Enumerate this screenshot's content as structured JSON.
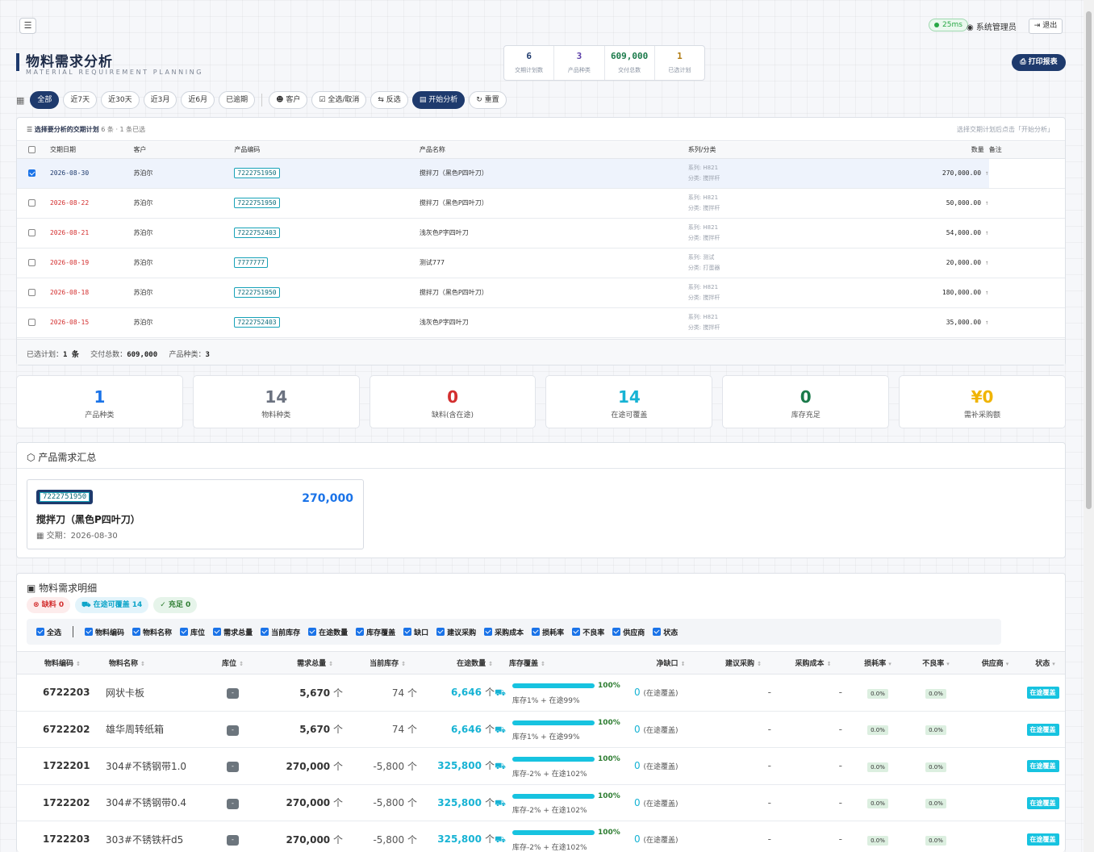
{
  "header": {
    "ping": "25ms",
    "user": "系统管理员",
    "logout": "退出",
    "title": "物料需求分析",
    "subtitle": "MATERIAL REQUIREMENT PLANNING",
    "print": "打印报表"
  },
  "stats": [
    {
      "value": "6",
      "label": "交期计划数",
      "color": "#1e3a6d"
    },
    {
      "value": "3",
      "label": "产品种类",
      "color": "#5b3ea8"
    },
    {
      "value": "609,000",
      "label": "交付总数",
      "color": "#1a7a4a"
    },
    {
      "value": "1",
      "label": "已选计划",
      "color": "#b07a10"
    }
  ],
  "filters": {
    "all": "全部",
    "d7": "近7天",
    "d30": "近30天",
    "m3": "近3月",
    "m6": "近6月",
    "overdue": "已逾期",
    "customer": "客户",
    "toggle_all": "全选/取消",
    "invert": "反选",
    "analyze": "开始分析",
    "reset": "重置"
  },
  "plans": {
    "title": "选择要分析的交期计划",
    "count": "6 条 · 1 条已选",
    "hint": "选择交期计划后点击「开始分析」",
    "columns": [
      "交期日期",
      "客户",
      "产品编码",
      "产品名称",
      "系列/分类",
      "数量",
      "备注"
    ],
    "rows": [
      {
        "date": "2026-08-30",
        "customer": "苏泊尔",
        "code": "7222751950",
        "name": "搅拌刀（黑色P四叶刀）",
        "series": "系列: H821",
        "category": "分类: 搅拌杆",
        "qty": "270,000.00"
      },
      {
        "date": "2026-08-22",
        "customer": "苏泊尔",
        "code": "7222751950",
        "name": "搅拌刀（黑色P四叶刀）",
        "series": "系列: H821",
        "category": "分类: 搅拌杆",
        "qty": "50,000.00"
      },
      {
        "date": "2026-08-21",
        "customer": "苏泊尔",
        "code": "7222752403",
        "name": "浅灰色P字四叶刀",
        "series": "系列: H821",
        "category": "分类: 搅拌杆",
        "qty": "54,000.00"
      },
      {
        "date": "2026-08-19",
        "customer": "苏泊尔",
        "code": "7777777",
        "name": "测试777",
        "series": "系列: 测试",
        "category": "分类: 打蛋器",
        "qty": "20,000.00"
      },
      {
        "date": "2026-08-18",
        "customer": "苏泊尔",
        "code": "7222751950",
        "name": "搅拌刀（黑色P四叶刀）",
        "series": "系列: H821",
        "category": "分类: 搅拌杆",
        "qty": "180,000.00"
      },
      {
        "date": "2026-08-15",
        "customer": "苏泊尔",
        "code": "7222752403",
        "name": "浅灰色P字四叶刀",
        "series": "系列: H821",
        "category": "分类: 搅拌杆",
        "qty": "35,000.00"
      }
    ],
    "footer": {
      "selected_label": "已选计划：",
      "selected": "1 条",
      "total_label": "交付总数：",
      "total": "609,000",
      "kinds_label": "产品种类：",
      "kinds": "3"
    }
  },
  "summary_cards": [
    {
      "value": "1",
      "label": "产品种类",
      "color": "#1a73e8"
    },
    {
      "value": "14",
      "label": "物料种类",
      "color": "#6b7280"
    },
    {
      "value": "0",
      "label": "缺料(含在途)",
      "color": "#d32f2f"
    },
    {
      "value": "14",
      "label": "在途可覆盖",
      "color": "#17b3d4"
    },
    {
      "value": "0",
      "label": "库存充足",
      "color": "#1a7a4a"
    },
    {
      "value": "¥0",
      "label": "需补采购额",
      "color": "#f0b400"
    }
  ],
  "product_summary": {
    "title": "产品需求汇总",
    "code": "7222751950",
    "qty": "270,000",
    "name": "搅拌刀（黑色P四叶刀）",
    "date": "交期：2026-08-30"
  },
  "materials": {
    "title": "物料需求明细",
    "badges": {
      "short": "缺料 0",
      "transit": "在途可覆盖 14",
      "enough": "充足 0"
    },
    "column_toggles": [
      "全选",
      "物料编码",
      "物料名称",
      "库位",
      "需求总量",
      "当前库存",
      "在途数量",
      "库存覆盖",
      "缺口",
      "建议采购",
      "采购成本",
      "损耗率",
      "不良率",
      "供应商",
      "状态"
    ],
    "columns": [
      "物料编码",
      "物料名称",
      "库位",
      "需求总量",
      "当前库存",
      "在途数量",
      "库存覆盖",
      "净缺口",
      "建议采购",
      "采购成本",
      "损耗率",
      "不良率",
      "供应商",
      "状态"
    ],
    "unit": "个",
    "rows": [
      {
        "code": "6722203",
        "name": "网状卡板",
        "loc": "-",
        "demand": "5,670",
        "stock": "74",
        "transit": "6,646",
        "pct": "100%",
        "cover": "库存1% + 在途99%",
        "gap": "0",
        "gap_note": "(在途覆盖)",
        "buy": "-",
        "cost": "-",
        "loss": "0.0%",
        "bad": "0.0%",
        "status": "在途覆盖"
      },
      {
        "code": "6722202",
        "name": "雄华周转纸箱",
        "loc": "-",
        "demand": "5,670",
        "stock": "74",
        "transit": "6,646",
        "pct": "100%",
        "cover": "库存1% + 在途99%",
        "gap": "0",
        "gap_note": "(在途覆盖)",
        "buy": "-",
        "cost": "-",
        "loss": "0.0%",
        "bad": "0.0%",
        "status": "在途覆盖"
      },
      {
        "code": "1722201",
        "name": "304#不锈钢带1.0",
        "loc": "-",
        "demand": "270,000",
        "stock": "-5,800",
        "transit": "325,800",
        "pct": "100%",
        "cover": "库存-2% + 在途102%",
        "gap": "0",
        "gap_note": "(在途覆盖)",
        "buy": "-",
        "cost": "-",
        "loss": "0.0%",
        "bad": "0.0%",
        "status": "在途覆盖"
      },
      {
        "code": "1722202",
        "name": "304#不锈钢带0.4",
        "loc": "-",
        "demand": "270,000",
        "stock": "-5,800",
        "transit": "325,800",
        "pct": "100%",
        "cover": "库存-2% + 在途102%",
        "gap": "0",
        "gap_note": "(在途覆盖)",
        "buy": "-",
        "cost": "-",
        "loss": "0.0%",
        "bad": "0.0%",
        "status": "在途覆盖"
      },
      {
        "code": "1722203",
        "name": "303#不锈铁杆d5",
        "loc": "-",
        "demand": "270,000",
        "stock": "-5,800",
        "transit": "325,800",
        "pct": "100%",
        "cover": "库存-2% + 在途102%",
        "gap": "0",
        "gap_note": "(在途覆盖)",
        "buy": "-",
        "cost": "-",
        "loss": "0.0%",
        "bad": "0.0%",
        "status": "在途覆盖"
      }
    ]
  }
}
